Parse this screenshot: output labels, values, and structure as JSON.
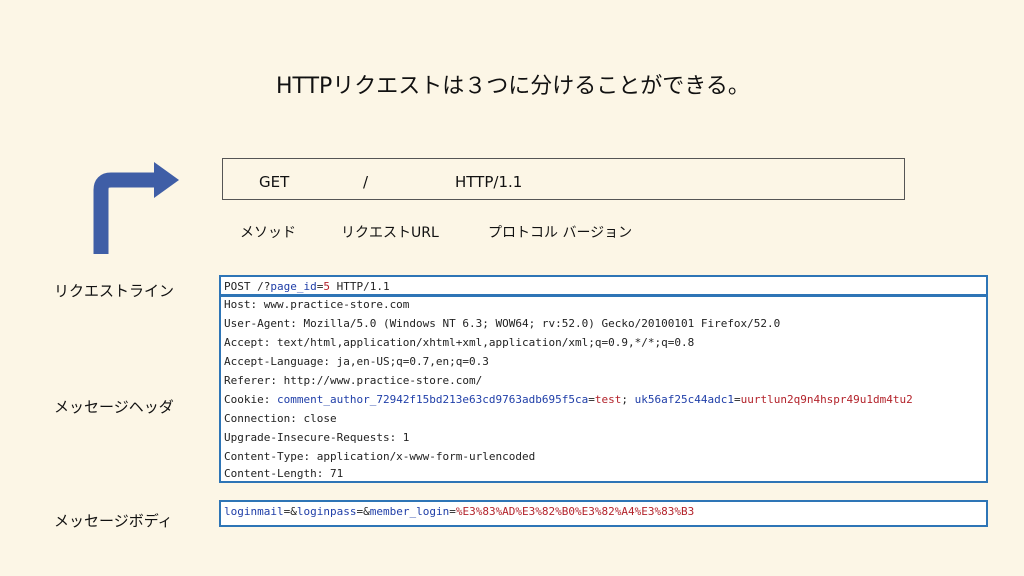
{
  "title": "HTTPリクエストは３つに分けることができる。",
  "request_line": {
    "method": "GET",
    "url": "/",
    "version": "HTTP/1.1",
    "captions": {
      "method": "メソッド",
      "url": "リクエストURL",
      "version": "プロトコル バージョン"
    }
  },
  "labels": {
    "request_line": "リクエストライン",
    "message_header": "メッセージヘッダ",
    "message_body": "メッセージボディ"
  },
  "arrow_color": "#3f5ea6",
  "raw_request": {
    "line": {
      "part1": "POST /?",
      "param": "page_id",
      "eq": "=",
      "value": "5",
      "part2": " HTTP/1.1"
    },
    "headers": [
      "Host: www.practice-store.com",
      "User-Agent: Mozilla/5.0 (Windows NT 6.3; WOW64; rv:52.0) Gecko/20100101 Firefox/52.0",
      "Accept: text/html,application/xhtml+xml,application/xml;q=0.9,*/*;q=0.8",
      "Accept-Language: ja,en-US;q=0.7,en;q=0.3",
      "Referer: http://www.practice-store.com/",
      "Connection: close",
      "Upgrade-Insecure-Requests: 1",
      "Content-Type: application/x-www-form-urlencoded",
      "Content-Length: 71"
    ],
    "cookie": {
      "prefix": "Cookie: ",
      "name1": "comment_author_72942f15bd213e63cd9763adb695f5ca",
      "eq1": "=",
      "value1": "test",
      "sep": "; ",
      "name2": "uk56af25c44adc1",
      "eq2": "=",
      "value2": "uurtlun2q9n4hspr49u1dm4tu2"
    },
    "body": {
      "k1": "loginmail",
      "e1": "=&",
      "k2": "loginpass",
      "e2": "=&",
      "k3": "member_login",
      "e3": "=",
      "v3": "%E3%83%AD%E3%82%B0%E3%82%A4%E3%83%B3"
    }
  }
}
